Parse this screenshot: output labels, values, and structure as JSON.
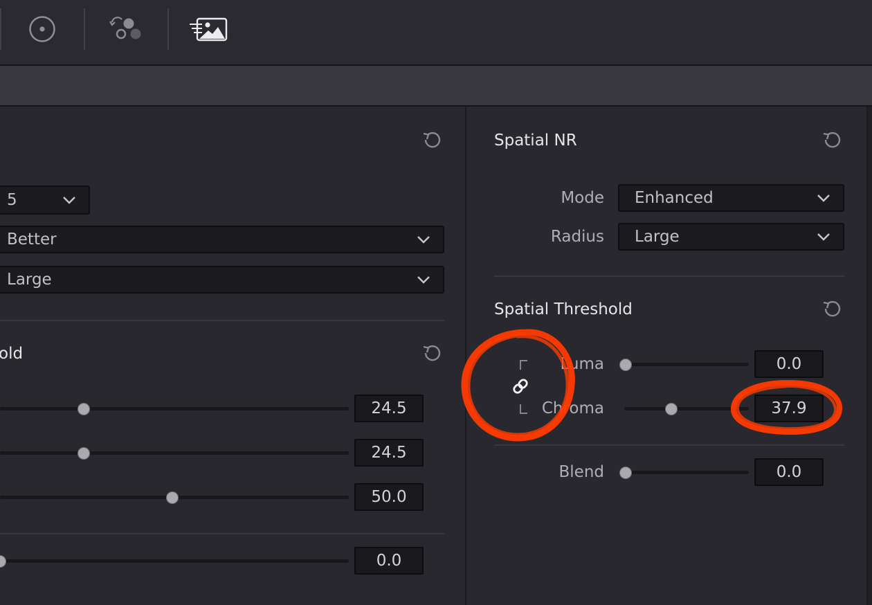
{
  "left_panel": {
    "dropdown_1": "5",
    "dropdown_2": "Better",
    "dropdown_3": "Large",
    "section_heading_partial": "old",
    "values": [
      "24.5",
      "24.5",
      "50.0",
      "0.0"
    ]
  },
  "right_panel": {
    "title": "Spatial NR",
    "mode_label": "Mode",
    "mode_value": "Enhanced",
    "radius_label": "Radius",
    "radius_value": "Large",
    "threshold_title": "Spatial Threshold",
    "luma_label": "Luma",
    "luma_value": "0.0",
    "chroma_label": "Chroma",
    "chroma_value": "37.9",
    "blend_label": "Blend",
    "blend_value": "0.0"
  },
  "icons": {
    "toolbar": [
      "target-icon",
      "color-nodes-icon",
      "motion-effects-icon"
    ],
    "reset": "reset-icon",
    "link": "link-icon",
    "chevron": "chevron-down-icon"
  },
  "colors": {
    "annotation": "#ff3b00",
    "background": "#28282e"
  }
}
